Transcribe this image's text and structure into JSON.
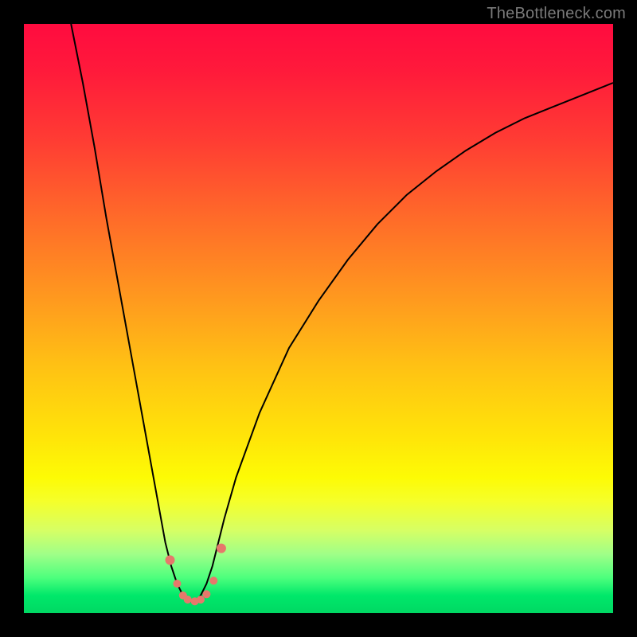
{
  "watermark": "TheBottleneck.com",
  "chart_data": {
    "type": "line",
    "title": "",
    "xlabel": "",
    "ylabel": "",
    "xlim": [
      0,
      100
    ],
    "ylim": [
      0,
      100
    ],
    "series": [
      {
        "name": "curve",
        "x": [
          8,
          10,
          12,
          14,
          16,
          18,
          20,
          22,
          24,
          25,
          26,
          27,
          28,
          29,
          30,
          31,
          32,
          33,
          34,
          36,
          40,
          45,
          50,
          55,
          60,
          65,
          70,
          75,
          80,
          85,
          90,
          95,
          100
        ],
        "y": [
          100,
          90,
          79,
          67,
          56,
          45,
          34,
          23,
          12,
          8,
          5,
          3,
          2,
          2,
          3,
          5,
          8,
          12,
          16,
          23,
          34,
          45,
          53,
          60,
          66,
          71,
          75,
          78.5,
          81.5,
          84,
          86,
          88,
          90
        ]
      }
    ],
    "dots": {
      "x": [
        24.8,
        26.0,
        27.0,
        27.8,
        29.0,
        30.0,
        31.0,
        32.2,
        33.5
      ],
      "y": [
        9.0,
        5.0,
        3.0,
        2.3,
        2.0,
        2.3,
        3.2,
        5.5,
        11.0
      ]
    },
    "gradient": {
      "stops": [
        {
          "pct": 0,
          "color": "#ff0b3f"
        },
        {
          "pct": 50,
          "color": "#ffb018"
        },
        {
          "pct": 78,
          "color": "#fcff08"
        },
        {
          "pct": 100,
          "color": "#00d863"
        }
      ]
    }
  }
}
